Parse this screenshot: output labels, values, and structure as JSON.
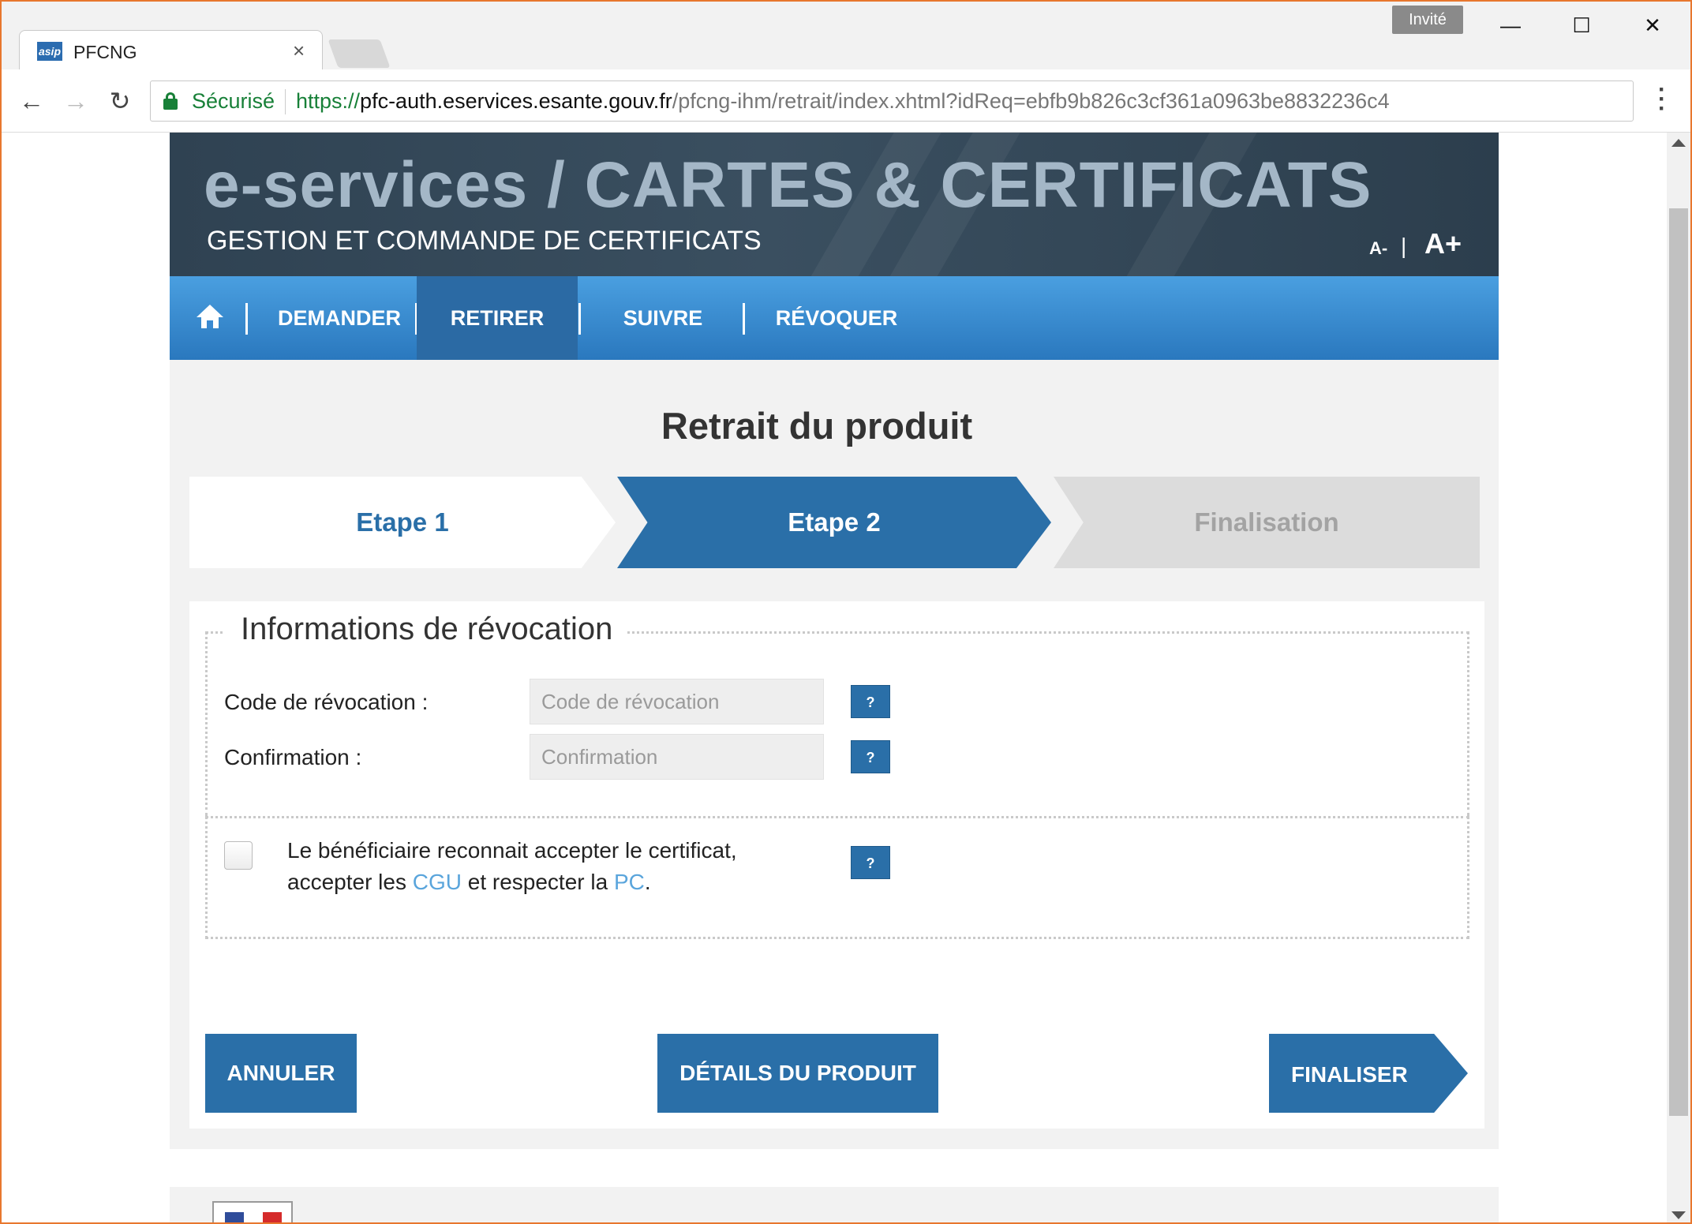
{
  "browser": {
    "tab_title": "PFCNG",
    "favicon_text": "asip",
    "guest_label": "Invité",
    "secure_label": "Sécurisé",
    "url_scheme": "https://",
    "url_host": "pfc-auth.eservices.esante.gouv.fr",
    "url_path": "/pfcng-ihm/retrait/index.xhtml?idReq=ebfb9b826c3cf361a0963be8832236c4"
  },
  "header": {
    "title": "e-services / CARTES & CERTIFICATS",
    "subtitle": "GESTION ET COMMANDE DE CERTIFICATS",
    "font_decrease": "A-",
    "font_separator": "|",
    "font_increase": "A+"
  },
  "nav": {
    "items": [
      {
        "label": "DEMANDER"
      },
      {
        "label": "RETIRER",
        "active": true
      },
      {
        "label": "SUIVRE"
      },
      {
        "label": "RÉVOQUER"
      }
    ]
  },
  "main": {
    "title": "Retrait du produit",
    "steps": [
      {
        "label": "Etape 1",
        "state": "done"
      },
      {
        "label": "Etape 2",
        "state": "current"
      },
      {
        "label": "Finalisation",
        "state": "pending"
      }
    ],
    "form": {
      "legend": "Informations de révocation",
      "code_label": "Code de révocation :",
      "code_placeholder": "Code de révocation",
      "confirm_label": "Confirmation :",
      "confirm_placeholder": "Confirmation",
      "help_label": "?",
      "agree_line1": "Le bénéficiaire reconnait accepter le certificat,",
      "agree_prefix": "accepter les ",
      "agree_cgu": "CGU",
      "agree_middle": " et respecter la ",
      "agree_pc": "PC",
      "agree_suffix": "."
    },
    "buttons": {
      "cancel": "ANNULER",
      "details": "DÉTAILS DU PRODUIT",
      "finish": "FINALISER"
    }
  },
  "colors": {
    "accent": "#2a6fa8",
    "nav_gradient_top": "#4a9fe0",
    "banner": "#2f4252",
    "window_border": "#e8772e"
  }
}
